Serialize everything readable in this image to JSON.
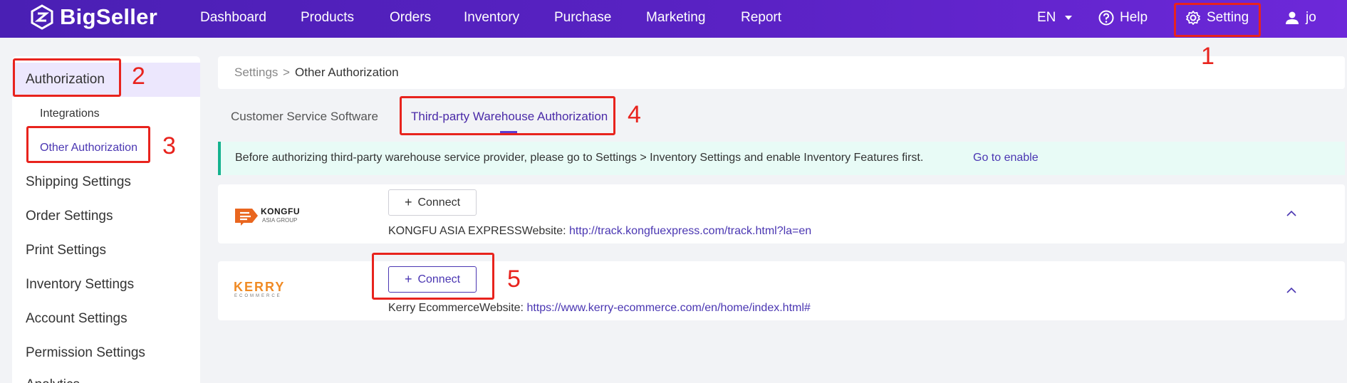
{
  "brand": {
    "name": "BigSeller"
  },
  "nav": {
    "items": [
      "Dashboard",
      "Products",
      "Orders",
      "Inventory",
      "Purchase",
      "Marketing",
      "Report"
    ],
    "lang": "EN",
    "help": "Help",
    "setting": "Setting",
    "user": "jo"
  },
  "sidebar": {
    "authorization": "Authorization",
    "integrations": "Integrations",
    "other_authorization": "Other Authorization",
    "shipping": "Shipping Settings",
    "order": "Order Settings",
    "print": "Print Settings",
    "inventory": "Inventory Settings",
    "account": "Account Settings",
    "permission": "Permission Settings",
    "cutoff": "Analytics"
  },
  "breadcrumb": {
    "root": "Settings",
    "sep": ">",
    "current": "Other Authorization"
  },
  "tabs": {
    "customer_service": "Customer Service Software",
    "warehouse": "Third-party Warehouse Authorization"
  },
  "notice": {
    "text": "Before authorizing third-party warehouse service provider, please go to Settings > Inventory Settings and enable Inventory Features first.",
    "link": "Go to enable"
  },
  "providers": [
    {
      "logo": "KONGFU",
      "logo_sub": "ASIA GROUP",
      "button": "Connect",
      "name": "KONGFU ASIA EXPRESS",
      "website_label": "Website:",
      "url": "http://track.kongfuexpress.com/track.html?la=en"
    },
    {
      "logo": "KERRY",
      "logo_sub": "ECOMMERCE",
      "button": "Connect",
      "name": "Kerry Ecommerce",
      "website_label": "Website:",
      "url": "https://www.kerry-ecommerce.com/en/home/index.html#"
    }
  ],
  "annotations": [
    "1",
    "2",
    "3",
    "4",
    "5"
  ],
  "colors": {
    "nav_bg": "#5a22c4",
    "accent": "#4a36b2",
    "annotation": "#e8231d",
    "notice_bg": "#e8fbf6"
  }
}
